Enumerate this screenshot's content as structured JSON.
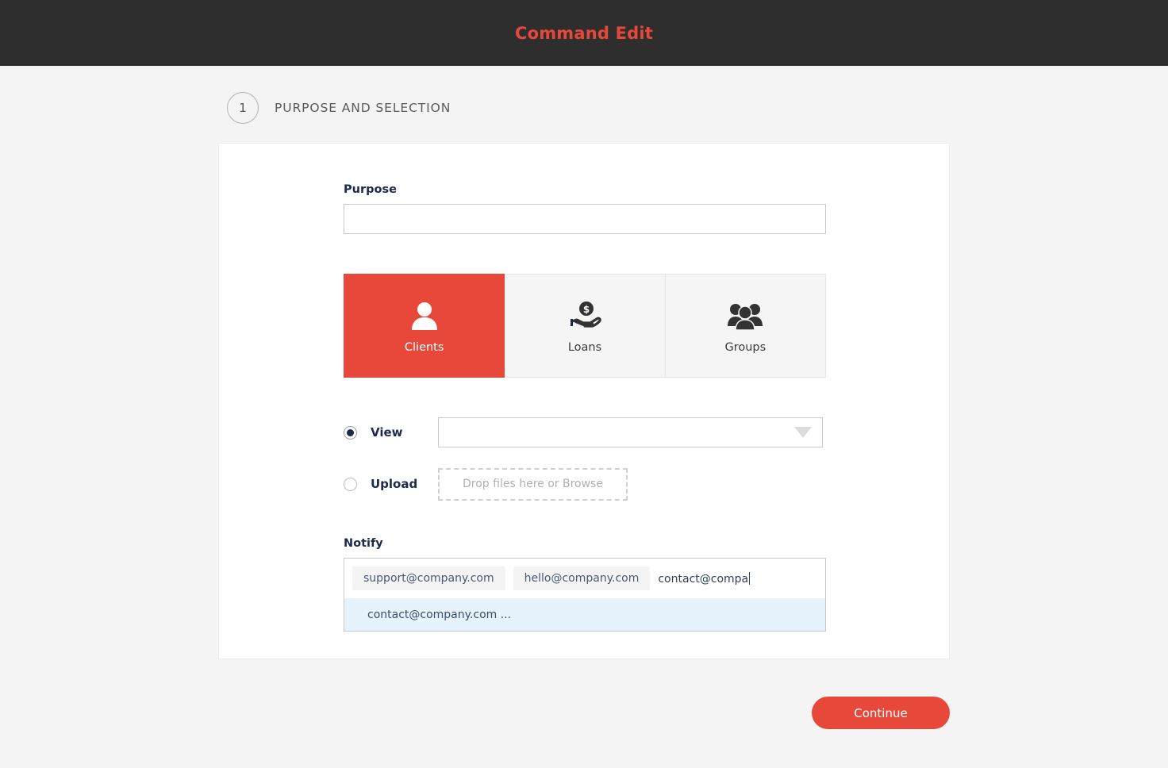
{
  "window": {
    "title": "Command Edit",
    "title_color": "#e8483a",
    "topbar_bg": "#2e2e2e"
  },
  "step": {
    "number": "1",
    "label": "PURPOSE AND SELECTION"
  },
  "form": {
    "purpose": {
      "label": "Purpose",
      "value": "",
      "placeholder": ""
    },
    "segmented": {
      "active_color": "#e8483a",
      "options": [
        {
          "label": "Clients",
          "icon": "person-icon",
          "active": true
        },
        {
          "label": "Loans",
          "icon": "hand-holding-coin-icon",
          "active": false
        },
        {
          "label": "Groups",
          "icon": "group-of-people-icon",
          "active": false
        }
      ]
    },
    "source": {
      "view": {
        "label": "View",
        "selected": true,
        "select_value": "",
        "caret_icon": "chevron-down-icon"
      },
      "upload": {
        "label": "Upload",
        "selected": false,
        "dropzone_text": "Drop files here or Browse"
      }
    },
    "notify": {
      "label": "Notify",
      "chips": [
        "support@company.com",
        "hello@company.com"
      ],
      "typed_value": "contact@compa",
      "suggestions": [
        "contact@company.com ..."
      ]
    }
  },
  "footer": {
    "continue_label": "Continue"
  }
}
